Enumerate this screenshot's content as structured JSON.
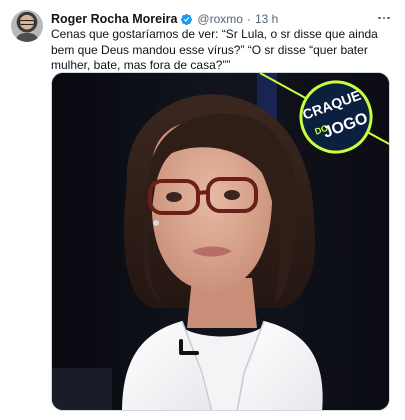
{
  "tweet": {
    "author_name": "Roger Rocha Moreira",
    "handle": "@roxmo",
    "separator": "·",
    "time": "13 h",
    "text": "Cenas que gostaríamos de ver: “Sr Lula, o sr disse que ainda bem que Deus mandou esse vírus?” “O sr disse “quer bater mulher, bate, mas fora de casa?””",
    "badge_lines": [
      "CRAQUE",
      "DO",
      "JOGO"
    ]
  },
  "colors": {
    "verified": "#1d9bf0",
    "badge_bg": "#0b1f3f",
    "badge_ring": "#c8ff3d",
    "text_secondary": "#536471"
  },
  "icons": {
    "verified": "verified-badge-icon",
    "more": "more-options-icon"
  }
}
